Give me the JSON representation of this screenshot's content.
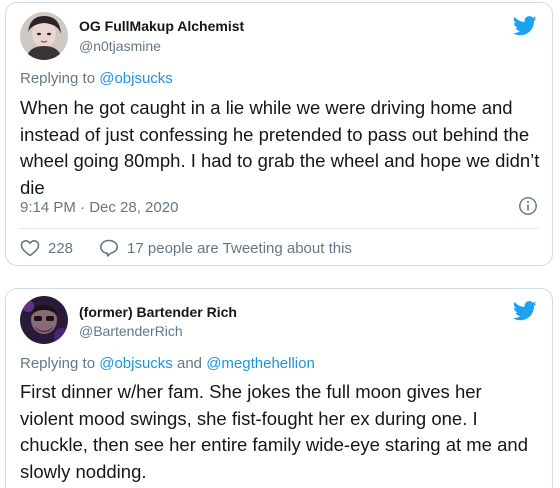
{
  "colors": {
    "brand_blue": "#1da1f2",
    "link_blue": "#1b95e0",
    "secondary_text": "#657786",
    "border": "#d3dce3"
  },
  "tweets": [
    {
      "author_name": "OG FullMakup Alchemist",
      "author_handle": "@n0tjasmine",
      "replying_prefix": "Replying to ",
      "replying_to": [
        "@objsucks"
      ],
      "text": "When he got caught in a lie while we were driving home and instead of just confessing he pretended to pass out behind the wheel going 80mph. I had to grab the wheel and hope we didn’t die",
      "timestamp": "9:14 PM · Dec 28, 2020",
      "likes": "228",
      "tweeting_about": "17 people are Tweeting about this",
      "icons": {
        "like": "heart-icon",
        "comment": "speech-bubble-icon",
        "info": "info-icon",
        "brand": "twitter-bird-icon"
      }
    },
    {
      "author_name": "(former) Bartender Rich",
      "author_handle": "@BartenderRich",
      "replying_prefix": "Replying to ",
      "replying_to": [
        "@objsucks",
        "@megthehellion"
      ],
      "replying_joiner": " and ",
      "text": "First dinner w/her fam. She jokes the full moon gives her violent mood swings, she fist-fought her ex during one. I chuckle, then see her entire family wide-eye staring at me and slowly nodding.",
      "icons": {
        "brand": "twitter-bird-icon"
      }
    }
  ]
}
